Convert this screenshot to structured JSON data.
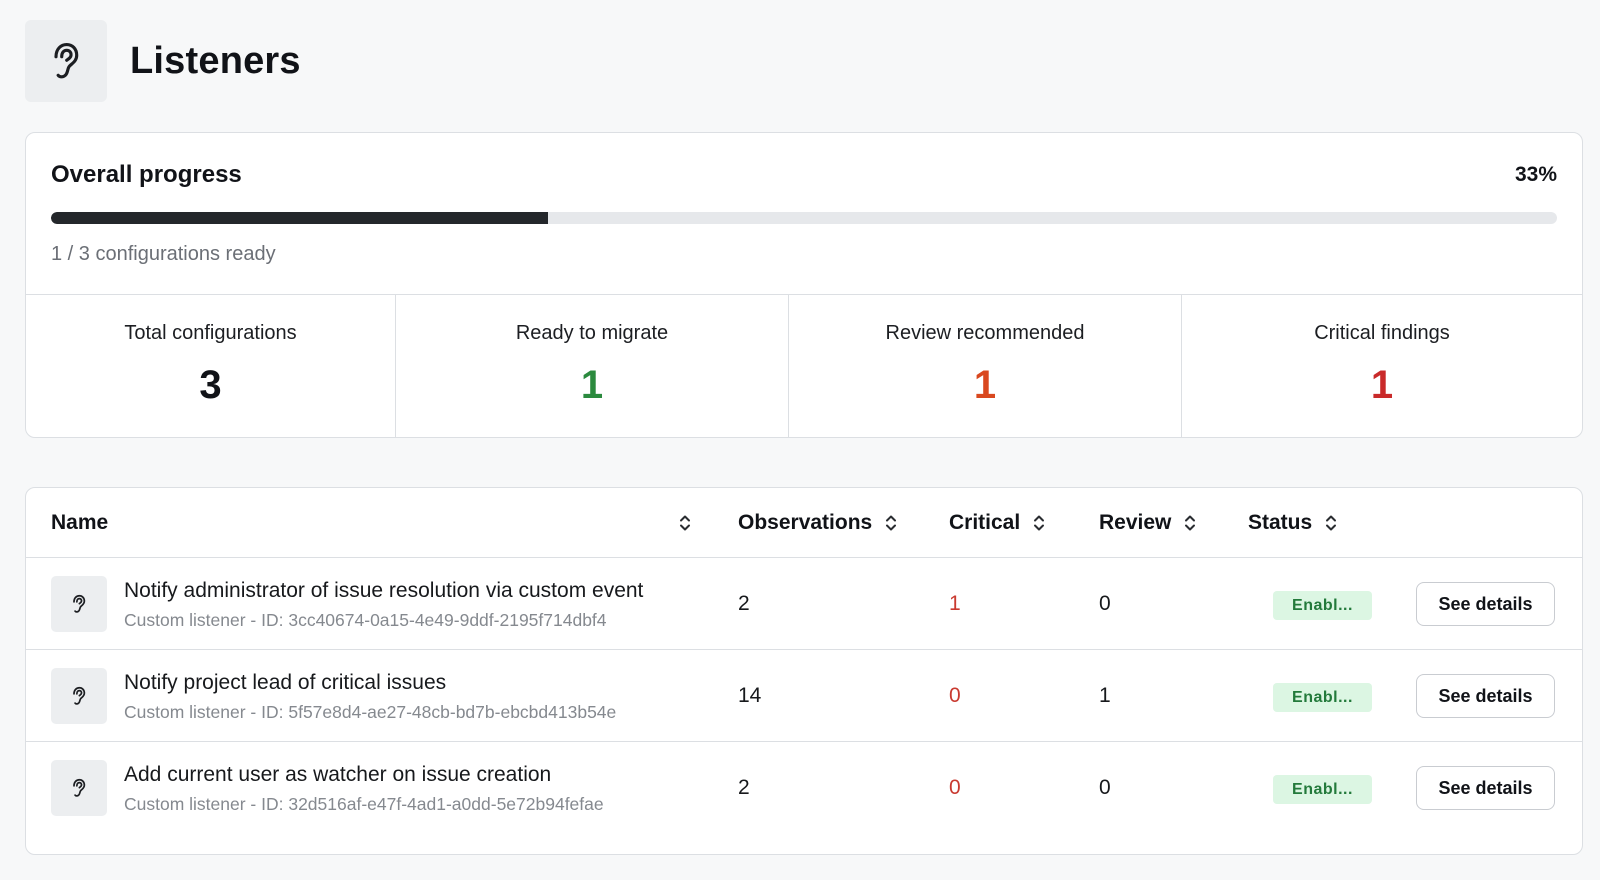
{
  "header": {
    "title": "Listeners",
    "icon": "ear-icon"
  },
  "progress": {
    "title": "Overall progress",
    "percent_label": "33%",
    "fraction": 0.33,
    "caption": "1 / 3 configurations ready"
  },
  "stats": [
    {
      "label": "Total configurations",
      "value": "3",
      "color": "#111318"
    },
    {
      "label": "Ready to migrate",
      "value": "1",
      "color": "#2b8a3e"
    },
    {
      "label": "Review recommended",
      "value": "1",
      "color": "#d9481f"
    },
    {
      "label": "Critical findings",
      "value": "1",
      "color": "#c92a2a"
    }
  ],
  "table": {
    "columns": {
      "name": "Name",
      "observations": "Observations",
      "critical": "Critical",
      "review": "Review",
      "status": "Status"
    },
    "rows": [
      {
        "name": "Notify administrator of issue resolution via custom event",
        "subtitle": "Custom listener - ID: 3cc40674-0a15-4e49-9ddf-2195f714dbf4",
        "observations": "2",
        "critical": "1",
        "review": "0",
        "status": "Enabl...",
        "action": "See details"
      },
      {
        "name": "Notify project lead of critical issues",
        "subtitle": "Custom listener - ID: 5f57e8d4-ae27-48cb-bd7b-ebcbd413b54e",
        "observations": "14",
        "critical": "0",
        "review": "1",
        "status": "Enabl...",
        "action": "See details"
      },
      {
        "name": "Add current user as watcher on issue creation",
        "subtitle": "Custom listener - ID: 32d516af-e47f-4ad1-a0dd-5e72b94fefae",
        "observations": "2",
        "critical": "0",
        "review": "0",
        "status": "Enabl...",
        "action": "See details"
      }
    ]
  },
  "colors": {
    "critical_text": "#c93a30",
    "badge_bg": "#dcf6e3",
    "badge_text": "#237a3b",
    "progress_fill": "#24272b"
  }
}
